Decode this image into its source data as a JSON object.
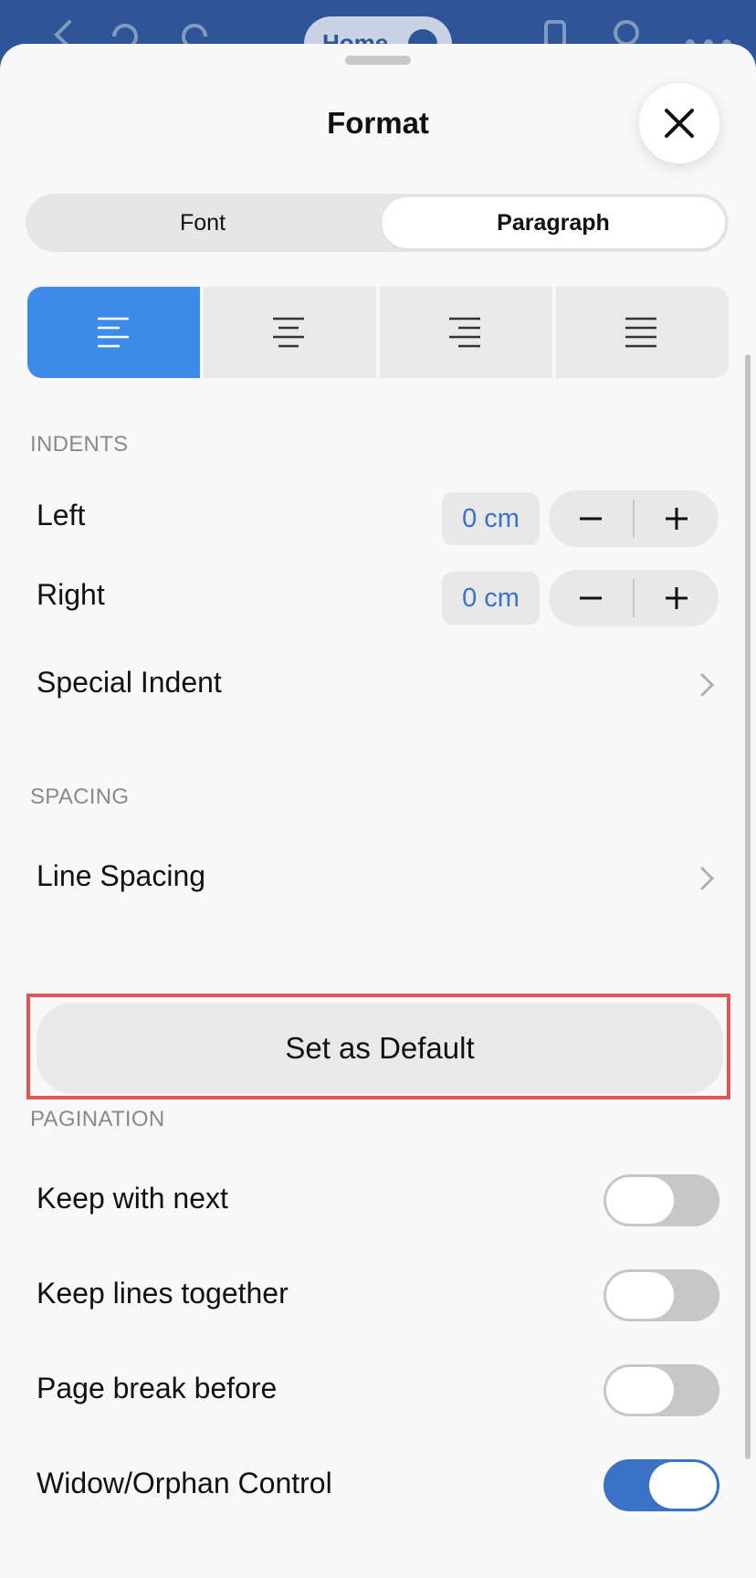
{
  "topbar": {
    "home_label": "Home"
  },
  "sheet": {
    "title": "Format"
  },
  "tabs": [
    {
      "label": "Font",
      "selected": false
    },
    {
      "label": "Paragraph",
      "selected": true
    }
  ],
  "alignment": {
    "options": [
      "align-left-icon",
      "align-center-icon",
      "align-right-icon",
      "align-justify-icon"
    ],
    "selected": "align-left-icon"
  },
  "indents": {
    "header": "INDENTS",
    "left": {
      "label": "Left",
      "value": "0 cm"
    },
    "right": {
      "label": "Right",
      "value": "0 cm"
    },
    "special_indent": {
      "label": "Special Indent"
    }
  },
  "spacing": {
    "header": "SPACING",
    "line_spacing": {
      "label": "Line Spacing"
    }
  },
  "set_default": {
    "label": "Set as Default"
  },
  "pagination": {
    "header": "PAGINATION",
    "items": [
      {
        "label": "Keep with next",
        "on": false
      },
      {
        "label": "Keep lines together",
        "on": false
      },
      {
        "label": "Page break before",
        "on": false
      },
      {
        "label": "Widow/Orphan Control",
        "on": true
      }
    ]
  },
  "colors": {
    "accent": "#3d8be8",
    "toggle_on": "#3a73c6",
    "highlight": "#e05656",
    "value_text": "#3a73c6"
  }
}
